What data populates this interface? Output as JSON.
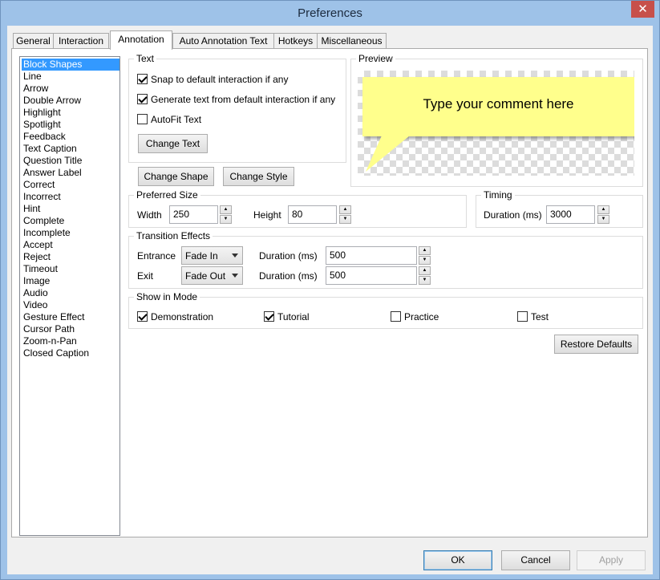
{
  "window": {
    "title": "Preferences",
    "close_glyph": "✕"
  },
  "tabs": [
    "General",
    "Interaction",
    "Annotation",
    "Auto Annotation Text",
    "Hotkeys",
    "Miscellaneous"
  ],
  "active_tab": "Annotation",
  "shape_list": {
    "selected": "Block Shapes",
    "items": [
      "Block Shapes",
      "Line",
      "Arrow",
      "Double Arrow",
      "Highlight",
      "Spotlight",
      "Feedback",
      "Text Caption",
      "Question Title",
      "Answer Label",
      "Correct",
      "Incorrect",
      "Hint",
      "Complete",
      "Incomplete",
      "Accept",
      "Reject",
      "Timeout",
      "Image",
      "Audio",
      "Video",
      "Gesture Effect",
      "Cursor Path",
      "Zoom-n-Pan",
      "Closed Caption"
    ]
  },
  "text_group": {
    "legend": "Text",
    "snap_label": "Snap to default interaction if any",
    "snap_checked": true,
    "generate_label": "Generate text from default interaction if any",
    "generate_checked": true,
    "autofit_label": "AutoFit Text",
    "autofit_checked": false,
    "change_text": "Change Text"
  },
  "buttons": {
    "change_shape": "Change Shape",
    "change_style": "Change Style",
    "restore_defaults": "Restore Defaults"
  },
  "preview": {
    "legend": "Preview",
    "bubble_text": "Type your comment here",
    "bubble_color": "#ffff8c"
  },
  "preferred_size": {
    "legend": "Preferred Size",
    "width_label": "Width",
    "width_value": "250",
    "height_label": "Height",
    "height_value": "80"
  },
  "timing": {
    "legend": "Timing",
    "duration_label": "Duration (ms)",
    "duration_value": "3000"
  },
  "transitions": {
    "legend": "Transition Effects",
    "entrance_label": "Entrance",
    "entrance_value": "Fade In",
    "entrance_duration_label": "Duration (ms)",
    "entrance_duration": "500",
    "exit_label": "Exit",
    "exit_value": "Fade Out",
    "exit_duration_label": "Duration (ms)",
    "exit_duration": "500"
  },
  "show_in_mode": {
    "legend": "Show in Mode",
    "demonstration": "Demonstration",
    "demonstration_checked": true,
    "tutorial": "Tutorial",
    "tutorial_checked": true,
    "practice": "Practice",
    "practice_checked": false,
    "test": "Test",
    "test_checked": false
  },
  "footer": {
    "ok": "OK",
    "cancel": "Cancel",
    "apply": "Apply"
  },
  "icons": {
    "up_arrow": "▲",
    "down_arrow": "▼"
  },
  "colors": {
    "title_bar": "#9ec2e8",
    "close_button": "#c7504b",
    "selection": "#3399ff"
  }
}
